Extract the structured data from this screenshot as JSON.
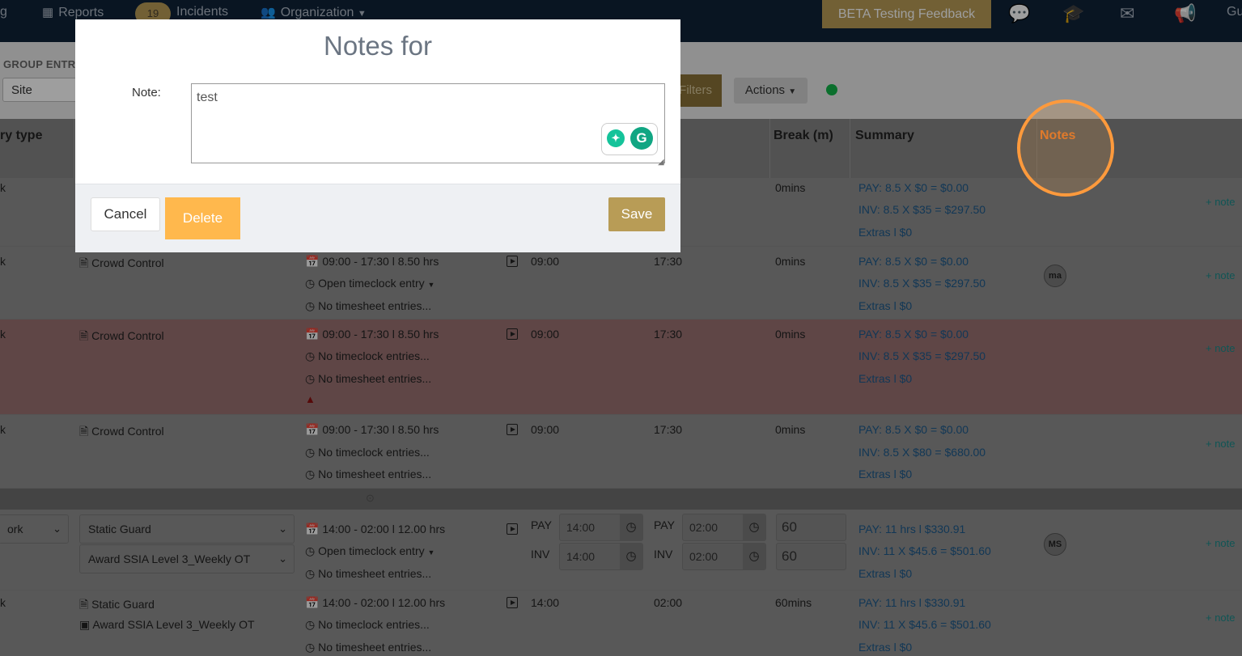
{
  "nav": {
    "item_left": "g",
    "reports": "Reports",
    "incidents_badge": "19",
    "incidents": "Incidents",
    "organization": "Organization",
    "beta": "BETA Testing Feedback",
    "user_partial": "Gu",
    "icons": [
      "chat-icon",
      "graduation-cap-icon",
      "envelope-icon",
      "megaphone-icon"
    ]
  },
  "toolbar": {
    "group_label": "GROUP ENTR",
    "site_value": "Site",
    "filters": "Filters",
    "actions": "Actions",
    "status_color": "#13b44a"
  },
  "table": {
    "headers": {
      "entry_type": "ry type",
      "break": "Break (m)",
      "summary": "Summary",
      "notes": "Notes"
    },
    "rows": [
      {
        "col1": "k",
        "break": "0mins",
        "pay": "PAY: 8.5 X $0 = $0.00",
        "inv": "INV: 8.5 X $35 = $297.50",
        "extras_label": "Extras l ",
        "extras_value": "$0",
        "note_link": "+ note"
      },
      {
        "col1": "k",
        "position": "Crowd Control",
        "shift": "09:00 - 17:30 l 8.50 hrs",
        "timeclock": "Open timeclock entry",
        "timesheet": "No timesheet entries...",
        "start": "09:00",
        "end": "17:30",
        "break": "0mins",
        "pay": "PAY: 8.5 X $0 = $0.00",
        "inv": "INV: 8.5 X $35 = $297.50",
        "extras_label": "Extras l ",
        "extras_value": "$0",
        "avatar": "ma",
        "note_link": "+ note"
      },
      {
        "col1": "k",
        "position": "Crowd Control",
        "shift": "09:00 - 17:30 l 8.50 hrs",
        "timeclock": "No timeclock entries...",
        "timesheet": "No timesheet entries...",
        "start": "09:00",
        "end": "17:30",
        "break": "0mins",
        "pay": "PAY: 8.5 X $0 = $0.00",
        "inv": "INV: 8.5 X $35 = $297.50",
        "extras_label": "Extras l ",
        "extras_value": "$0",
        "note_link": "+ note"
      },
      {
        "col1": "k",
        "position": "Crowd Control",
        "shift": "09:00 - 17:30 l 8.50 hrs",
        "timeclock": "No timeclock entries...",
        "timesheet": "No timesheet entries...",
        "start": "09:00",
        "end": "17:30",
        "break": "0mins",
        "pay": "PAY: 8.5 X $0 = $0.00",
        "inv": "INV: 8.5 X $80 = $680.00",
        "extras_label": "Extras l ",
        "extras_value": "$0",
        "note_link": "+ note"
      },
      {
        "col1": "ork",
        "position": "Static Guard",
        "award": "Award SSIA Level 3_Weekly OT",
        "shift": "14:00 - 02:00 l 12.00 hrs",
        "timeclock": "Open timeclock entry",
        "timesheet": "No timesheet entries...",
        "pay_label": "PAY",
        "inv_label": "INV",
        "start_pay": "14:00",
        "start_inv": "14:00",
        "end_pay": "02:00",
        "end_inv": "02:00",
        "break_pay": "60",
        "break_inv": "60",
        "pay": "PAY: 11 hrs l $330.91",
        "inv": "INV: 11 X $45.6 = $501.60",
        "extras_label": "Extras l ",
        "extras_value": "$0",
        "avatar": "MS",
        "note_link": "+ note"
      },
      {
        "col1": "k",
        "position": "Static Guard",
        "award": "Award SSIA Level 3_Weekly OT",
        "shift": "14:00 - 02:00 l 12.00 hrs",
        "timeclock": "No timeclock entries...",
        "timesheet": "No timesheet entries...",
        "start": "14:00",
        "end": "02:00",
        "break": "60mins",
        "pay": "PAY: 11 hrs l $330.91",
        "inv": "INV: 11 X $45.6 = $501.60",
        "extras_label": "Extras l ",
        "extras_value": "$0",
        "note_link": "+ note"
      }
    ]
  },
  "modal": {
    "title": "Notes for",
    "note_label": "Note:",
    "note_value": "test",
    "cancel": "Cancel",
    "delete": "Delete",
    "save": "Save",
    "grammarly_letter": "G"
  }
}
